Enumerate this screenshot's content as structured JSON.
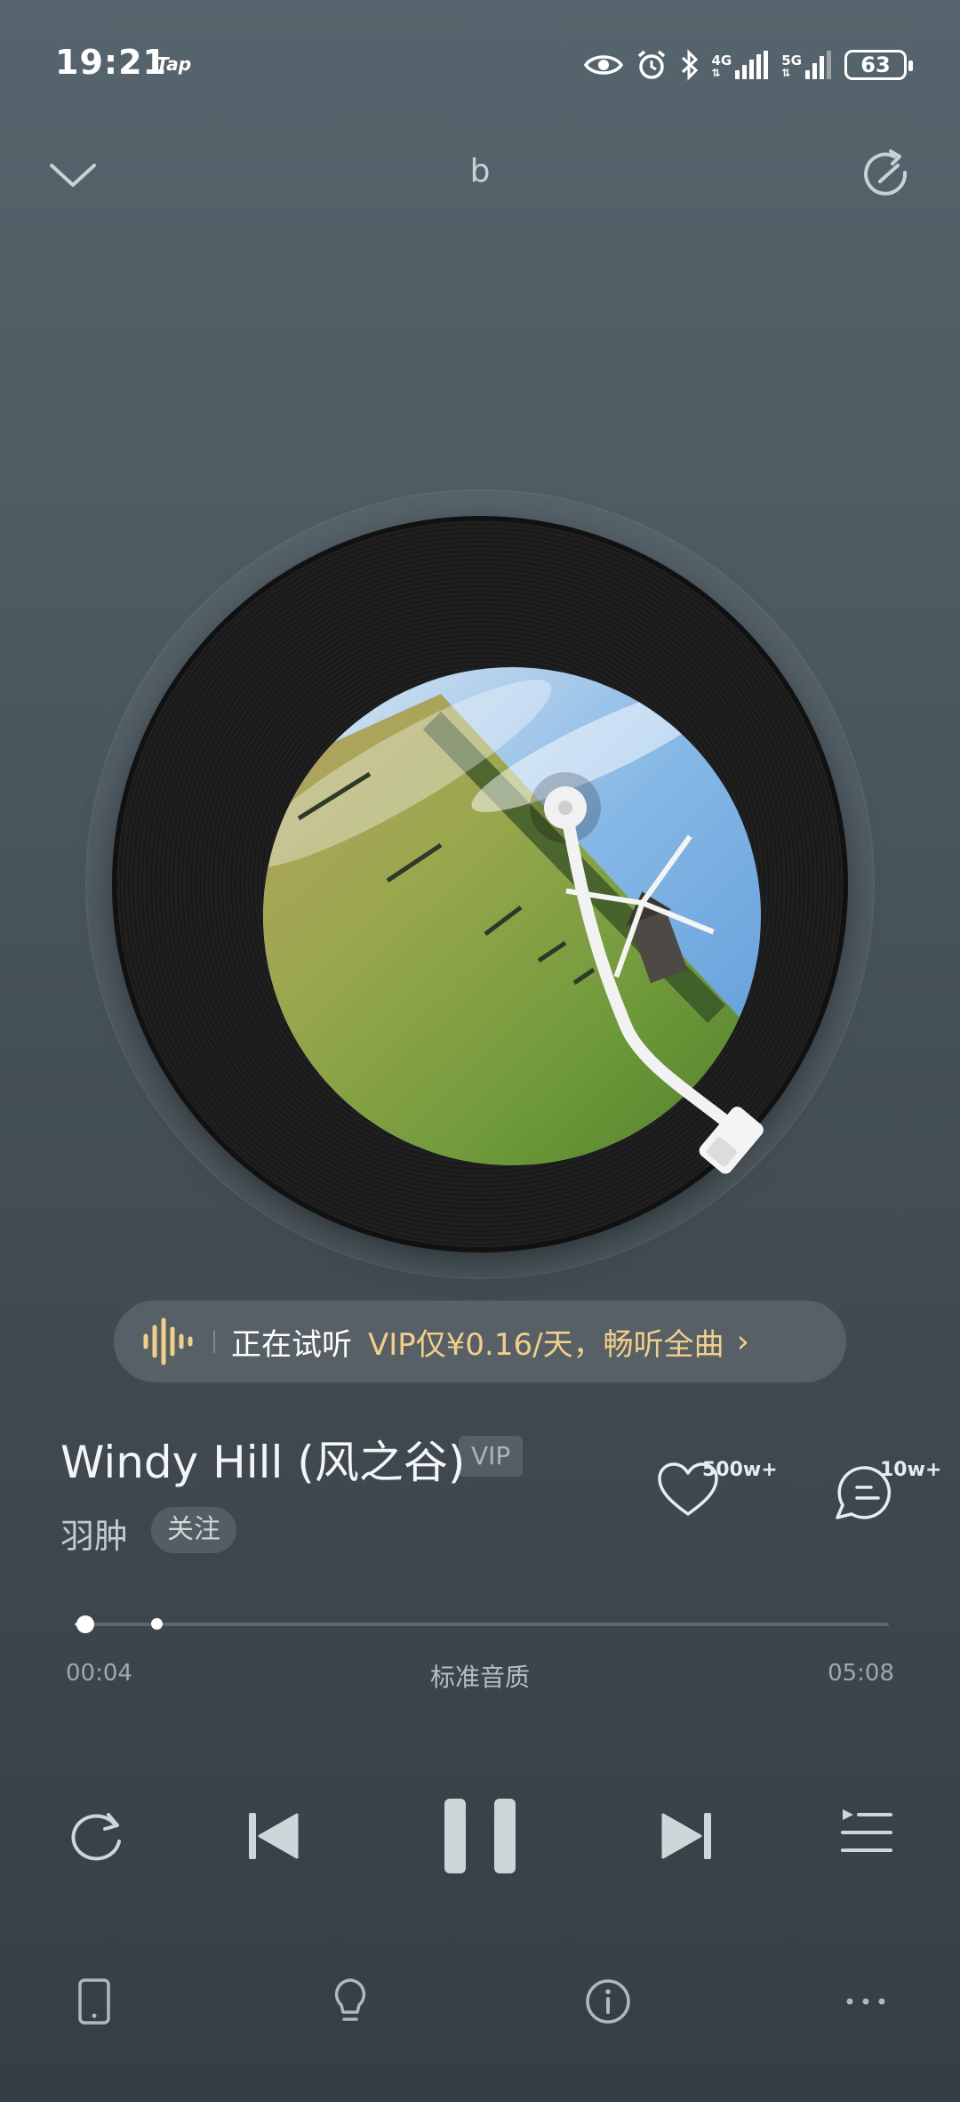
{
  "status_bar": {
    "time": "19:21",
    "carrier_tag": "Tap",
    "net1": "4G",
    "net2": "5G",
    "battery": "63"
  },
  "header": {
    "title": "b"
  },
  "banner": {
    "status": "正在试听",
    "offer": "VIP仅¥0.16/天，畅听全曲",
    "arrow": "›"
  },
  "song": {
    "title": "Windy Hill (风之谷)",
    "tag": "VIP",
    "artist": "羽肿",
    "follow": "关注",
    "likes": "500w+",
    "comments": "10w+"
  },
  "progress": {
    "current": "00:04",
    "total": "05:08",
    "quality": "标准音质",
    "played_fraction": 0.013,
    "buffered_fraction": 0.1
  },
  "colors": {
    "accent_gold": "#f2cf88",
    "background_top": "#56656d",
    "background_bottom": "#353e43"
  }
}
